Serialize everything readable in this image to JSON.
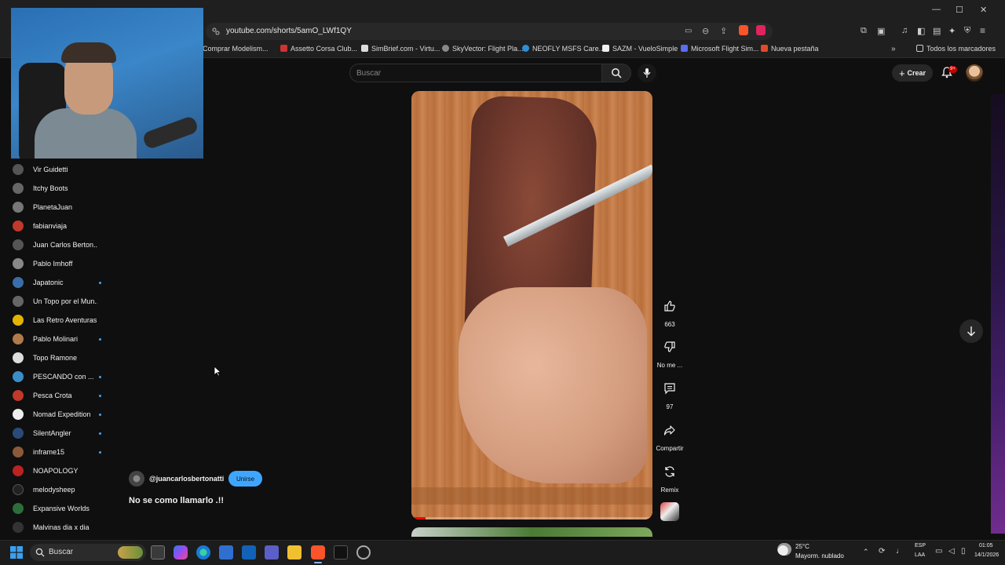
{
  "browser": {
    "url": "youtube.com/shorts/5amO_LWf1QY",
    "bookmarks": [
      {
        "label": "Comprar Modelism...",
        "color": "#444"
      },
      {
        "label": "Assetto Corsa Club...",
        "color": "#c33"
      },
      {
        "label": "SimBrief.com - Virtu...",
        "color": "#ddd"
      },
      {
        "label": "SkyVector: Flight Pla...",
        "color": "#888"
      },
      {
        "label": "NEOFLY MSFS Care...",
        "color": "#2a8fd8"
      },
      {
        "label": "SAZM - VueloSimple",
        "color": "#eee"
      },
      {
        "label": "Microsoft Flight Sim...",
        "color": "#5a6cf0"
      },
      {
        "label": "Nueva pestaña",
        "color": "#e04a2a"
      }
    ],
    "all_bookmarks_label": "Todos los marcadores"
  },
  "header": {
    "search_placeholder": "Buscar",
    "create_label": "Crear",
    "notifications_badge": "9+"
  },
  "sidebar": {
    "subscriptions": [
      {
        "name": "Vir Guidetti",
        "color": "#555",
        "new": false
      },
      {
        "name": "Itchy Boots",
        "color": "#666",
        "new": false
      },
      {
        "name": "PlanetaJuan",
        "color": "#777",
        "new": false
      },
      {
        "name": "fabianviaja",
        "color": "#c0392b",
        "new": false
      },
      {
        "name": "Juan Carlos Berton...",
        "color": "#555",
        "new": false
      },
      {
        "name": "Pablo Imhoff",
        "color": "#888",
        "new": false
      },
      {
        "name": "Japatonic",
        "color": "#3a6ea8",
        "new": true
      },
      {
        "name": "Un Topo por el Mun...",
        "color": "#666",
        "new": false
      },
      {
        "name": "Las Retro Aventuras",
        "color": "#e2b400",
        "new": false
      },
      {
        "name": "Pablo Molinari",
        "color": "#b07a4a",
        "new": true
      },
      {
        "name": "Topo Ramone",
        "color": "#ddd",
        "new": false
      },
      {
        "name": "PESCANDO con ...",
        "color": "#3a8ec8",
        "new": true
      },
      {
        "name": "Pesca Crota",
        "color": "#c0392b",
        "new": true
      },
      {
        "name": "Nomad Expedition",
        "color": "#eee",
        "new": true
      },
      {
        "name": "SilentAngler",
        "color": "#2a4a7a",
        "new": true
      },
      {
        "name": "inframe15",
        "color": "#8a5a3a",
        "new": true
      },
      {
        "name": "NOAPOLOGY",
        "color": "#b22",
        "new": false
      },
      {
        "name": "melodysheep",
        "color": "#222",
        "new": false
      },
      {
        "name": "Expansive Worlds",
        "color": "#2c6e3a",
        "new": false
      },
      {
        "name": "Malvinas dia x dia",
        "color": "#333",
        "new": false
      }
    ]
  },
  "short": {
    "channel": "@juancarlosbertonatti",
    "join_label": "Unirse",
    "title": "No se como llamarlo .!!",
    "likes": "663",
    "dislike_label": "No me ...",
    "comments": "97",
    "share_label": "Compartir",
    "remix_label": "Remix",
    "progress": 0.06
  },
  "taskbar": {
    "search_label": "Buscar",
    "weather_temp": "25°C",
    "weather_desc": "Mayorm. nublado",
    "lang_line1": "ESP",
    "lang_line2": "LAA",
    "time": "01:05",
    "date": "14/1/2026"
  }
}
